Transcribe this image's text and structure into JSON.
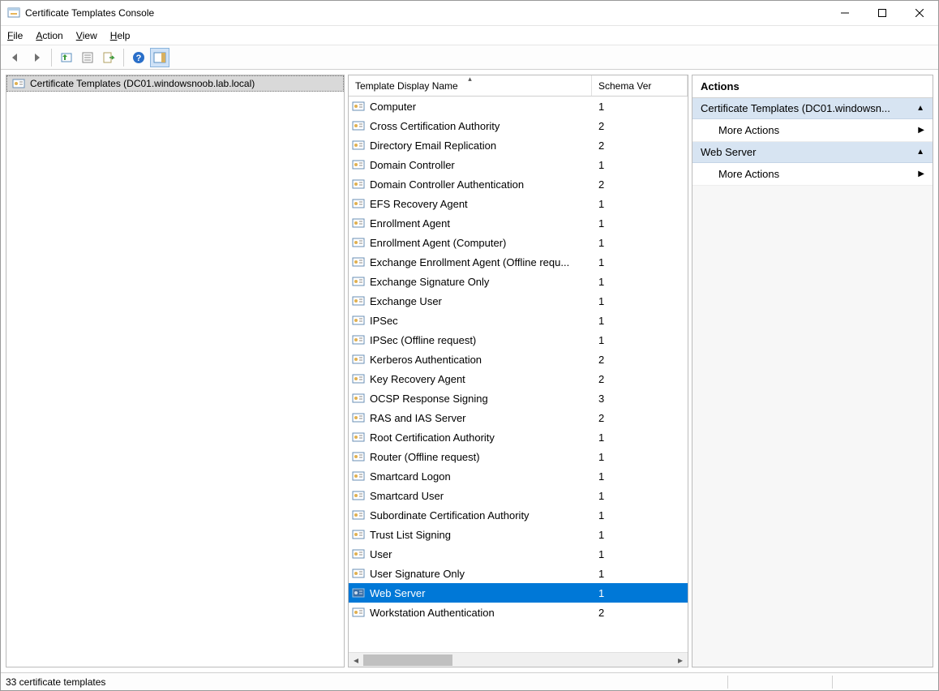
{
  "window": {
    "title": "Certificate Templates Console"
  },
  "menu": {
    "file": "File",
    "action": "Action",
    "view": "View",
    "help": "Help"
  },
  "tree": {
    "root": "Certificate Templates (DC01.windowsnoob.lab.local)"
  },
  "list": {
    "columns": {
      "name": "Template Display Name",
      "ver": "Schema Ver"
    },
    "rows": [
      {
        "name": "Computer",
        "ver": "1"
      },
      {
        "name": "Cross Certification Authority",
        "ver": "2"
      },
      {
        "name": "Directory Email Replication",
        "ver": "2"
      },
      {
        "name": "Domain Controller",
        "ver": "1"
      },
      {
        "name": "Domain Controller Authentication",
        "ver": "2"
      },
      {
        "name": "EFS Recovery Agent",
        "ver": "1"
      },
      {
        "name": "Enrollment Agent",
        "ver": "1"
      },
      {
        "name": "Enrollment Agent (Computer)",
        "ver": "1"
      },
      {
        "name": "Exchange Enrollment Agent (Offline requ...",
        "ver": "1"
      },
      {
        "name": "Exchange Signature Only",
        "ver": "1"
      },
      {
        "name": "Exchange User",
        "ver": "1"
      },
      {
        "name": "IPSec",
        "ver": "1"
      },
      {
        "name": "IPSec (Offline request)",
        "ver": "1"
      },
      {
        "name": "Kerberos Authentication",
        "ver": "2"
      },
      {
        "name": "Key Recovery Agent",
        "ver": "2"
      },
      {
        "name": "OCSP Response Signing",
        "ver": "3"
      },
      {
        "name": "RAS and IAS Server",
        "ver": "2"
      },
      {
        "name": "Root Certification Authority",
        "ver": "1"
      },
      {
        "name": "Router (Offline request)",
        "ver": "1"
      },
      {
        "name": "Smartcard Logon",
        "ver": "1"
      },
      {
        "name": "Smartcard User",
        "ver": "1"
      },
      {
        "name": "Subordinate Certification Authority",
        "ver": "1"
      },
      {
        "name": "Trust List Signing",
        "ver": "1"
      },
      {
        "name": "User",
        "ver": "1"
      },
      {
        "name": "User Signature Only",
        "ver": "1"
      },
      {
        "name": "Web Server",
        "ver": "1",
        "selected": true
      },
      {
        "name": "Workstation Authentication",
        "ver": "2"
      }
    ]
  },
  "actions": {
    "title": "Actions",
    "group1": "Certificate Templates (DC01.windowsn...",
    "more1": "More Actions",
    "group2": "Web Server",
    "more2": "More Actions"
  },
  "status": {
    "count": "33 certificate templates"
  }
}
